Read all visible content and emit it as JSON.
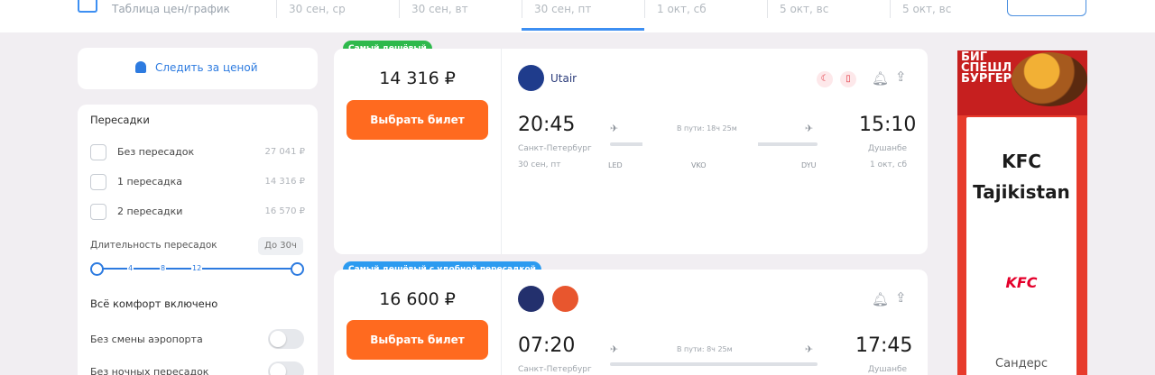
{
  "topbar": {
    "label": "Таблица цен/график",
    "dates": [
      "30 сен, ср",
      "30 сен, вт",
      "30 сен, пт",
      "1 окт, сб",
      "5 окт, вс",
      "5 окт, вс"
    ]
  },
  "notify": {
    "label": "Следить за ценой"
  },
  "filters": {
    "stops_title": "Пересадки",
    "options": [
      {
        "label": "Без пересадок",
        "price": "27 041 ₽"
      },
      {
        "label": "1 пересадка",
        "price": "14 316 ₽"
      },
      {
        "label": "2 пересадки",
        "price": "16 570 ₽"
      }
    ],
    "duration_title": "Длительность пересадок",
    "duration_badge": "До 30ч",
    "ticks": [
      "4",
      "8",
      "12"
    ],
    "comfort_title": "Всё комфорт включено",
    "toggles": [
      {
        "label": "Без смены аэропорта"
      },
      {
        "label": "Без ночных пересадок"
      }
    ]
  },
  "tickets": [
    {
      "badge": "Самый дешёвый",
      "price": "14 316 ₽",
      "buy_label": "Выбрать билет",
      "airline": "Utair",
      "dep_time": "20:45",
      "arr_time": "15:10",
      "dep_city": "Санкт-Петербург",
      "dep_date": "30 сен, пт",
      "arr_city": "Душанбе",
      "arr_date": "1 окт, сб",
      "duration": "В пути: 18ч 25м",
      "codes": [
        "LED",
        "VKO",
        "DYU"
      ]
    },
    {
      "badge": "Самый дешёвый с удобной пересадкой",
      "price": "16 600 ₽",
      "buy_label": "Выбрать билет",
      "dep_time": "07:20",
      "arr_time": "17:45",
      "dep_city": "Санкт-Петербург",
      "duration": "В пути: 8ч 25м",
      "arr_city": "Душанбе"
    }
  ],
  "ad": {
    "headline": "БИГ СПЕШЛ БУРГЕР",
    "title": "KFC Tajikistan",
    "logo": "KFC",
    "footer": "Сандерс"
  },
  "colors": {
    "accent": "#2d7be0",
    "buy": "#ff6a1f",
    "badge_green": "#2eb94c",
    "badge_blue": "#2c9bf0"
  },
  "icons": [
    "calendar-icon",
    "bell-icon",
    "share-icon",
    "plane-takeoff-icon",
    "plane-landing-icon"
  ]
}
